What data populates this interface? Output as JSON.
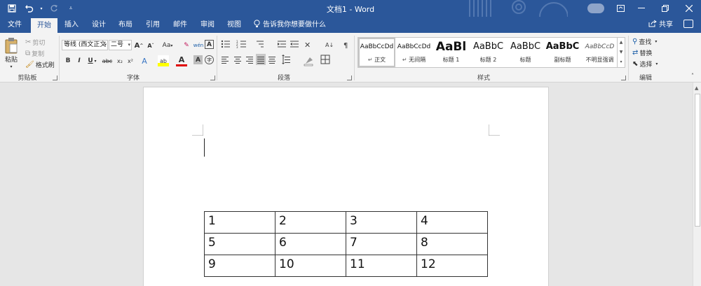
{
  "window": {
    "title": "文档1 - Word"
  },
  "qat": {
    "save_icon": "save-icon",
    "undo_icon": "undo-icon",
    "redo_icon": "redo-icon",
    "customize_icon": "customize-qat-icon"
  },
  "tabs": [
    {
      "label": "文件"
    },
    {
      "label": "开始"
    },
    {
      "label": "插入"
    },
    {
      "label": "设计"
    },
    {
      "label": "布局"
    },
    {
      "label": "引用"
    },
    {
      "label": "邮件"
    },
    {
      "label": "审阅"
    },
    {
      "label": "视图"
    }
  ],
  "tellme": "告诉我你想要做什么",
  "share": "共享",
  "clipboard": {
    "paste": "粘贴",
    "cut": "剪切",
    "copy": "复制",
    "format_painter": "格式刷",
    "group_label": "剪贴板"
  },
  "font": {
    "name": "等线 (西文正⽂",
    "size": "二号",
    "grow": "A",
    "shrink": "A",
    "case": "Aa",
    "clear": "✎",
    "phonetic": "wén",
    "border_char": "A",
    "bold": "B",
    "italic": "I",
    "underline": "U",
    "strike": "abc",
    "subscript": "x₂",
    "superscript": "x²",
    "effects": "A",
    "highlight": "ab",
    "color": "A",
    "shade": "A",
    "enclose": "字",
    "group_label": "字体"
  },
  "paragraph": {
    "group_label": "段落"
  },
  "styles": {
    "items": [
      {
        "preview": "AaBbCcDd",
        "name": "正文",
        "selected": true
      },
      {
        "preview": "AaBbCcDd",
        "name": "无间隔"
      },
      {
        "preview": "AaBl",
        "name": "标题 1"
      },
      {
        "preview": "AaBbC",
        "name": "标题 2"
      },
      {
        "preview": "AaBbC",
        "name": "标题"
      },
      {
        "preview": "AaBbC",
        "name": "副标题"
      },
      {
        "preview": "AaBbCcD",
        "name": "不明显强调"
      }
    ],
    "group_label": "样式"
  },
  "editing": {
    "find": "查找",
    "replace": "替换",
    "select": "选择",
    "group_label": "编辑"
  },
  "document": {
    "table": [
      [
        "1",
        "2",
        "3",
        "4"
      ],
      [
        "5",
        "6",
        "7",
        "8"
      ],
      [
        "9",
        "10",
        "11",
        "12"
      ]
    ]
  },
  "colors": {
    "brand": "#2b579a",
    "highlight": "#ffff00",
    "font_color": "#e00000"
  }
}
